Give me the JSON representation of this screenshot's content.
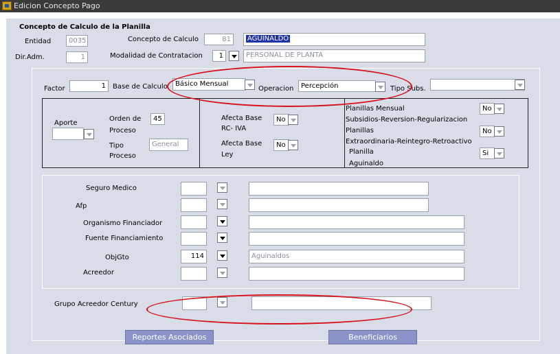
{
  "window": {
    "title": "Edicion Concepto Pago"
  },
  "header": {
    "section_title": "Concepto de Calculo de la Planilla",
    "entidad_label": "Entidad",
    "entidad_value": "0035",
    "concepto_label": "Concepto de Calculo",
    "concepto_code": "81",
    "concepto_name": "AGUINALDO",
    "diradm_label": "Dir.Adm.",
    "diradm_value": "1",
    "modalidad_label": "Modalidad de Contratacion",
    "modalidad_code": "1",
    "modalidad_name": "PERSONAL DE PLANTA"
  },
  "calc": {
    "factor_label": "Factor",
    "factor_value": "1",
    "base_label": "Base de Calculo",
    "base_value": "Básico Mensual",
    "operacion_label": "Operacion",
    "operacion_value": "Percepción",
    "tiposubs_label": "Tipo Subs.",
    "tiposubs_value": ""
  },
  "aporte": {
    "aporte_label": "Aporte",
    "orden_label_1": "Orden de",
    "orden_label_2": "Proceso",
    "orden_value": "45",
    "tipo_label_1": "Tipo",
    "tipo_label_2": "Proceso",
    "tipo_value": "General"
  },
  "afecta": {
    "rciva_label_1": "Afecta Base",
    "rciva_label_2": "RC- IVA",
    "rciva_value": "No",
    "ley_label_1": "Afecta Base",
    "ley_label_2": "Ley",
    "ley_value": "No"
  },
  "planillas": {
    "mensual_label": "Planillas Mensual",
    "mensual_value": "No",
    "subsidios_label_1": "Subsidios-Reversion-Regularizacion",
    "subsidios_label_2": "Planillas",
    "subsidios_value": "No",
    "extra_label_1": "Extraordinaria-Reintegro-Retroactivo",
    "extra_label_2": "Planilla",
    "extra_value": "Si",
    "aguinaldo_label": "Aguinaldo"
  },
  "fuentes": {
    "seguro_label": "Seguro Medico",
    "afp_label": "Afp",
    "organismo_label": "Organismo Financiador",
    "fuente_label": "Fuente Financiamiento",
    "objgto_label": "ObjGto",
    "objgto_code": "114",
    "objgto_desc": "Aguinaldos",
    "acreedor_label": "Acreedor"
  },
  "century": {
    "label": "Grupo Acreedor Century"
  },
  "buttons": {
    "reportes": "Reportes Asociados",
    "beneficiarios": "Beneficiarios"
  },
  "colors": {
    "annotation": "#d8101a",
    "button": "#8b93c8",
    "form_bg": "#d8dde8",
    "selection": "#1f33a6"
  }
}
